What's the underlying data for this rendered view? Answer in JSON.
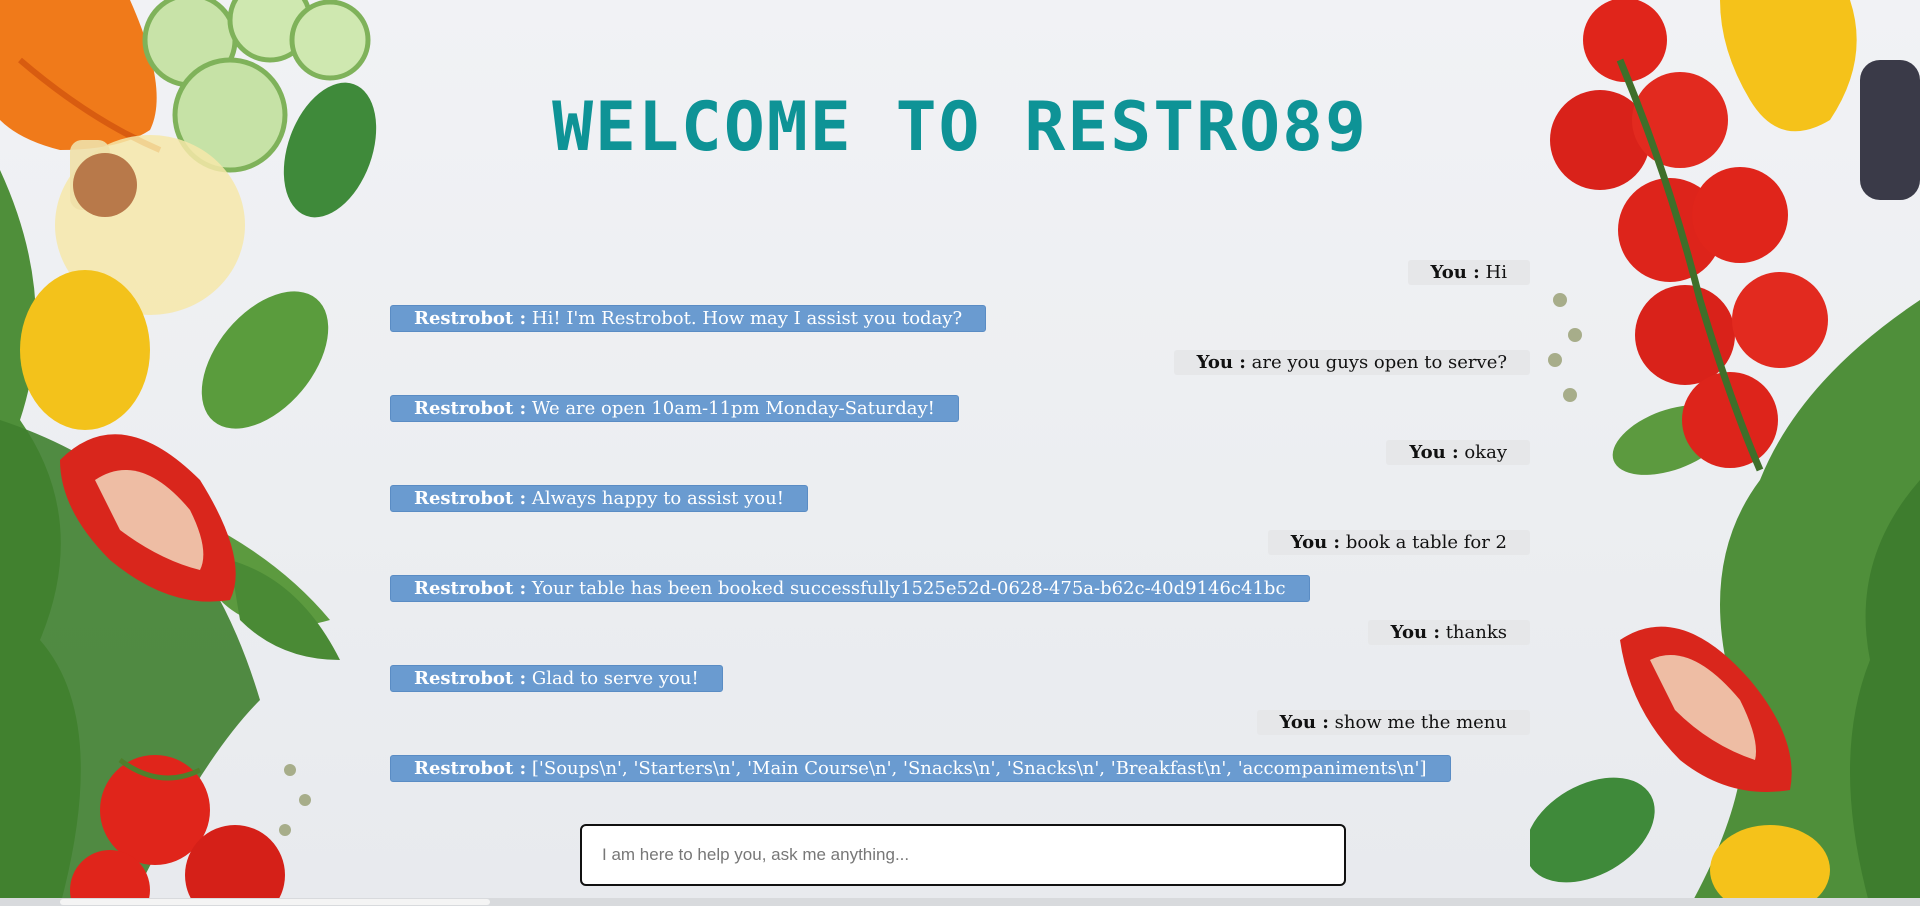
{
  "header": {
    "title": "WELCOME TO RESTRO89"
  },
  "chat": {
    "messages": [
      {
        "user_speaker": "You :",
        "user_text": "Hi",
        "bot_speaker": "Restrobot :",
        "bot_text": "Hi! I'm Restrobot. How may I assist you today?"
      },
      {
        "user_speaker": "You :",
        "user_text": "are you guys open to serve?",
        "bot_speaker": "Restrobot :",
        "bot_text": "We are open 10am-11pm Monday-Saturday!"
      },
      {
        "user_speaker": "You :",
        "user_text": "okay",
        "bot_speaker": "Restrobot :",
        "bot_text": "Always happy to assist you!"
      },
      {
        "user_speaker": "You :",
        "user_text": "book a table for 2",
        "bot_speaker": "Restrobot :",
        "bot_text": "Your table has been booked successfully1525e52d-0628-475a-b62c-40d9146c41bc"
      },
      {
        "user_speaker": "You :",
        "user_text": "thanks",
        "bot_speaker": "Restrobot :",
        "bot_text": "Glad to serve you!"
      },
      {
        "user_speaker": "You :",
        "user_text": "show me the menu",
        "bot_speaker": "Restrobot :",
        "bot_text": "['Soups\\n', 'Starters\\n', 'Main Course\\n', 'Snacks\\n', 'Snacks\\n', 'Breakfast\\n', 'accompaniments\\n']"
      }
    ]
  },
  "input": {
    "placeholder": "I am here to help you, ask me anything...",
    "value": ""
  },
  "colors": {
    "title": "#0e9396",
    "bot_bubble": "#6a9bd0",
    "user_bubble": "#e6e7e9"
  }
}
